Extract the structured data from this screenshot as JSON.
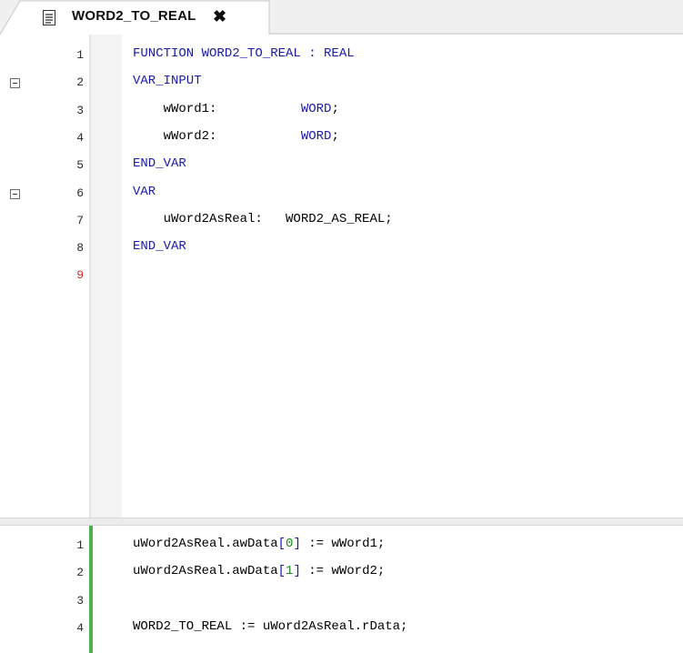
{
  "tab": {
    "title": "WORD2_TO_REAL",
    "close_glyph": "✖",
    "icon": "document-icon"
  },
  "declaration": {
    "lines": [
      {
        "num": "1",
        "parts": [
          {
            "t": "FUNCTION WORD2_TO_REAL : REAL",
            "c": "kw"
          }
        ]
      },
      {
        "num": "2",
        "parts": [
          {
            "t": "VAR_INPUT",
            "c": "kw"
          }
        ]
      },
      {
        "num": "3",
        "parts": [
          {
            "t": "    wWord1:           ",
            "c": ""
          },
          {
            "t": "WORD",
            "c": "kw"
          },
          {
            "t": ";",
            "c": ""
          }
        ]
      },
      {
        "num": "4",
        "parts": [
          {
            "t": "    wWord2:           ",
            "c": ""
          },
          {
            "t": "WORD",
            "c": "kw"
          },
          {
            "t": ";",
            "c": ""
          }
        ]
      },
      {
        "num": "5",
        "parts": [
          {
            "t": "END_VAR",
            "c": "kw"
          }
        ]
      },
      {
        "num": "6",
        "parts": [
          {
            "t": "VAR",
            "c": "kw"
          }
        ]
      },
      {
        "num": "7",
        "parts": [
          {
            "t": "    uWord2AsReal:   WORD2_AS_REAL;",
            "c": ""
          }
        ]
      },
      {
        "num": "8",
        "parts": [
          {
            "t": "END_VAR",
            "c": "kw"
          }
        ]
      },
      {
        "num": "9",
        "parts": []
      }
    ],
    "fold_lines": [
      "2",
      "6"
    ],
    "current_line": "9"
  },
  "implementation": {
    "lines": [
      {
        "num": "1",
        "parts": [
          {
            "t": "uWord2AsReal.awData",
            "c": ""
          },
          {
            "t": "[",
            "c": "op"
          },
          {
            "t": "0",
            "c": "num"
          },
          {
            "t": "]",
            "c": "op"
          },
          {
            "t": " := wWord1;",
            "c": ""
          }
        ]
      },
      {
        "num": "2",
        "parts": [
          {
            "t": "uWord2AsReal.awData",
            "c": ""
          },
          {
            "t": "[",
            "c": "op"
          },
          {
            "t": "1",
            "c": "num"
          },
          {
            "t": "]",
            "c": "op"
          },
          {
            "t": " := wWord2;",
            "c": ""
          }
        ]
      },
      {
        "num": "3",
        "parts": []
      },
      {
        "num": "4",
        "parts": [
          {
            "t": "WORD2_TO_REAL := uWord2AsReal.rData;",
            "c": ""
          }
        ]
      }
    ]
  },
  "colors": {
    "keyword": "#1a1ab0",
    "number": "#1a8a1a",
    "changed_marker": "#4caf50",
    "current_line_number": "#c62828"
  }
}
